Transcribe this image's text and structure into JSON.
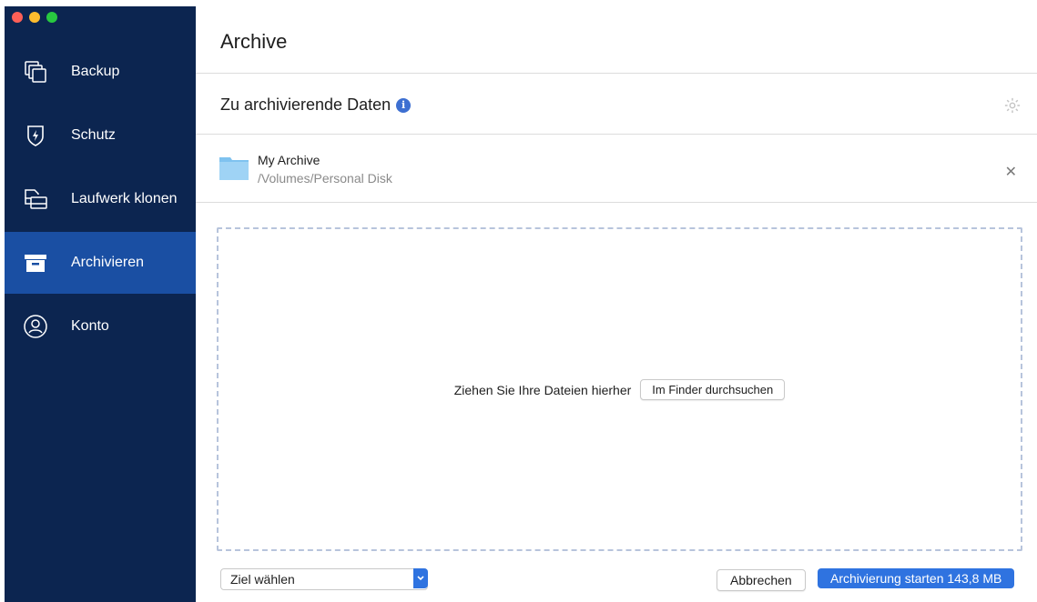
{
  "window": {
    "traffic_lights": {
      "close": "#fd5f57",
      "minimize": "#febc2e",
      "zoom": "#28c840"
    }
  },
  "sidebar": {
    "items": [
      {
        "label": "Backup",
        "icon": "backup-icon"
      },
      {
        "label": "Schutz",
        "icon": "shield-icon"
      },
      {
        "label": "Laufwerk klonen",
        "icon": "disk-clone-icon"
      },
      {
        "label": "Archivieren",
        "icon": "archive-box-icon",
        "active": true
      },
      {
        "label": "Konto",
        "icon": "account-icon"
      }
    ]
  },
  "main": {
    "title": "Archive",
    "section_title": "Zu archivierende Daten",
    "archive_item": {
      "name": "My Archive",
      "path": "/Volumes/Personal Disk"
    },
    "drop_text": "Ziehen Sie Ihre Dateien hierher",
    "browse_label": "Im Finder durchsuchen"
  },
  "footer": {
    "target_select": "Ziel wählen",
    "cancel_label": "Abbrechen",
    "start_label": "Archivierung starten 143,8 MB"
  },
  "colors": {
    "sidebar_bg": "#0c2550",
    "sidebar_active": "#1a4fa3",
    "accent": "#2f73e0"
  }
}
